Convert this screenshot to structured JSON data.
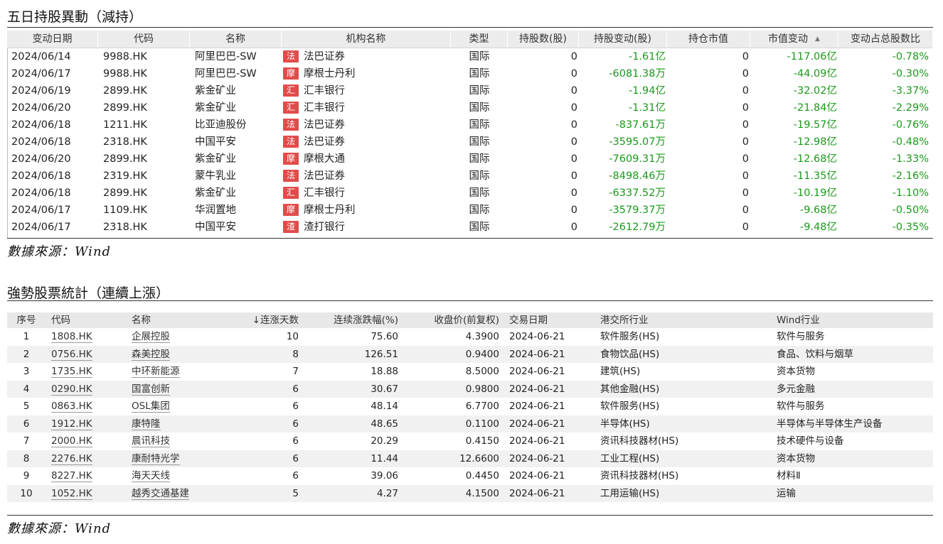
{
  "section1": {
    "title": "五日持股異動（減持）",
    "source": "數據來源：Wind",
    "headers": [
      "变动日期",
      "代码",
      "名称",
      "机构名称",
      "类型",
      "持股数(股)",
      "持股变动(股)",
      "持仓市值",
      "市值变动",
      "变动占总股数比"
    ],
    "sort_icon": "▲",
    "rows": [
      {
        "date": "2024/06/14",
        "code": "9988.HK",
        "name": "阿里巴巴-SW",
        "badge": "法",
        "inst": "法巴证券",
        "type": "国际",
        "shares": "0",
        "change": "-1.61亿",
        "mv": "0",
        "mv_change": "-117.06亿",
        "pct": "-0.78%"
      },
      {
        "date": "2024/06/17",
        "code": "9988.HK",
        "name": "阿里巴巴-SW",
        "badge": "摩",
        "inst": "摩根士丹利",
        "type": "国际",
        "shares": "0",
        "change": "-6081.38万",
        "mv": "0",
        "mv_change": "-44.09亿",
        "pct": "-0.30%"
      },
      {
        "date": "2024/06/19",
        "code": "2899.HK",
        "name": "紫金矿业",
        "badge": "汇",
        "inst": "汇丰银行",
        "type": "国际",
        "shares": "0",
        "change": "-1.94亿",
        "mv": "0",
        "mv_change": "-32.02亿",
        "pct": "-3.37%"
      },
      {
        "date": "2024/06/20",
        "code": "2899.HK",
        "name": "紫金矿业",
        "badge": "汇",
        "inst": "汇丰银行",
        "type": "国际",
        "shares": "0",
        "change": "-1.31亿",
        "mv": "0",
        "mv_change": "-21.84亿",
        "pct": "-2.29%"
      },
      {
        "date": "2024/06/18",
        "code": "1211.HK",
        "name": "比亚迪股份",
        "badge": "法",
        "inst": "法巴证券",
        "type": "国际",
        "shares": "0",
        "change": "-837.61万",
        "mv": "0",
        "mv_change": "-19.57亿",
        "pct": "-0.76%"
      },
      {
        "date": "2024/06/18",
        "code": "2318.HK",
        "name": "中国平安",
        "badge": "法",
        "inst": "法巴证券",
        "type": "国际",
        "shares": "0",
        "change": "-3595.07万",
        "mv": "0",
        "mv_change": "-12.98亿",
        "pct": "-0.48%"
      },
      {
        "date": "2024/06/20",
        "code": "2899.HK",
        "name": "紫金矿业",
        "badge": "摩",
        "inst": "摩根大通",
        "type": "国际",
        "shares": "0",
        "change": "-7609.31万",
        "mv": "0",
        "mv_change": "-12.68亿",
        "pct": "-1.33%"
      },
      {
        "date": "2024/06/18",
        "code": "2319.HK",
        "name": "蒙牛乳业",
        "badge": "法",
        "inst": "法巴证券",
        "type": "国际",
        "shares": "0",
        "change": "-8498.46万",
        "mv": "0",
        "mv_change": "-11.35亿",
        "pct": "-2.16%"
      },
      {
        "date": "2024/06/18",
        "code": "2899.HK",
        "name": "紫金矿业",
        "badge": "汇",
        "inst": "汇丰银行",
        "type": "国际",
        "shares": "0",
        "change": "-6337.52万",
        "mv": "0",
        "mv_change": "-10.19亿",
        "pct": "-1.10%"
      },
      {
        "date": "2024/06/17",
        "code": "1109.HK",
        "name": "华润置地",
        "badge": "摩",
        "inst": "摩根士丹利",
        "type": "国际",
        "shares": "0",
        "change": "-3579.37万",
        "mv": "0",
        "mv_change": "-9.68亿",
        "pct": "-0.50%"
      },
      {
        "date": "2024/06/17",
        "code": "2318.HK",
        "name": "中国平安",
        "badge": "渣",
        "inst": "渣打银行",
        "type": "国际",
        "shares": "0",
        "change": "-2612.79万",
        "mv": "0",
        "mv_change": "-9.48亿",
        "pct": "-0.35%"
      }
    ]
  },
  "section2": {
    "title": "強勢股票統計（連續上漲）",
    "source": "數據來源：Wind",
    "headers": [
      "序号",
      "代码",
      "名称",
      "↓连涨天数",
      "连续涨跌幅(%)",
      "收盘价(前复权)",
      "交易日期",
      "港交所行业",
      "Wind行业"
    ],
    "rows": [
      {
        "no": "1",
        "code": "1808.HK",
        "name": "企展控股",
        "days": "10",
        "pct": "75.60",
        "close": "4.3900",
        "date": "2024-06-21",
        "hkex": "软件服务(HS)",
        "wind": "软件与服务"
      },
      {
        "no": "2",
        "code": "0756.HK",
        "name": "森美控股",
        "days": "8",
        "pct": "126.51",
        "close": "0.9400",
        "date": "2024-06-21",
        "hkex": "食物饮品(HS)",
        "wind": "食品、饮料与烟草"
      },
      {
        "no": "3",
        "code": "1735.HK",
        "name": "中环新能源",
        "days": "7",
        "pct": "18.88",
        "close": "8.5000",
        "date": "2024-06-21",
        "hkex": "建筑(HS)",
        "wind": "资本货物"
      },
      {
        "no": "4",
        "code": "0290.HK",
        "name": "国富创新",
        "days": "6",
        "pct": "30.67",
        "close": "0.9800",
        "date": "2024-06-21",
        "hkex": "其他金融(HS)",
        "wind": "多元金融"
      },
      {
        "no": "5",
        "code": "0863.HK",
        "name": "OSL集团",
        "days": "6",
        "pct": "48.14",
        "close": "6.7700",
        "date": "2024-06-21",
        "hkex": "软件服务(HS)",
        "wind": "软件与服务"
      },
      {
        "no": "6",
        "code": "1912.HK",
        "name": "康特隆",
        "days": "6",
        "pct": "48.65",
        "close": "0.1100",
        "date": "2024-06-21",
        "hkex": "半导体(HS)",
        "wind": "半导体与半导体生产设备"
      },
      {
        "no": "7",
        "code": "2000.HK",
        "name": "晨讯科技",
        "days": "6",
        "pct": "20.29",
        "close": "0.4150",
        "date": "2024-06-21",
        "hkex": "资讯科技器材(HS)",
        "wind": "技术硬件与设备"
      },
      {
        "no": "8",
        "code": "2276.HK",
        "name": "康耐特光学",
        "days": "6",
        "pct": "11.44",
        "close": "12.6600",
        "date": "2024-06-21",
        "hkex": "工业工程(HS)",
        "wind": "资本货物"
      },
      {
        "no": "9",
        "code": "8227.HK",
        "name": "海天天线",
        "days": "6",
        "pct": "39.06",
        "close": "0.4450",
        "date": "2024-06-21",
        "hkex": "资讯科技器材(HS)",
        "wind": "材料Ⅱ"
      },
      {
        "no": "10",
        "code": "1052.HK",
        "name": "越秀交通基建",
        "days": "5",
        "pct": "4.27",
        "close": "4.1500",
        "date": "2024-06-21",
        "hkex": "工用运输(HS)",
        "wind": "运输"
      }
    ]
  }
}
